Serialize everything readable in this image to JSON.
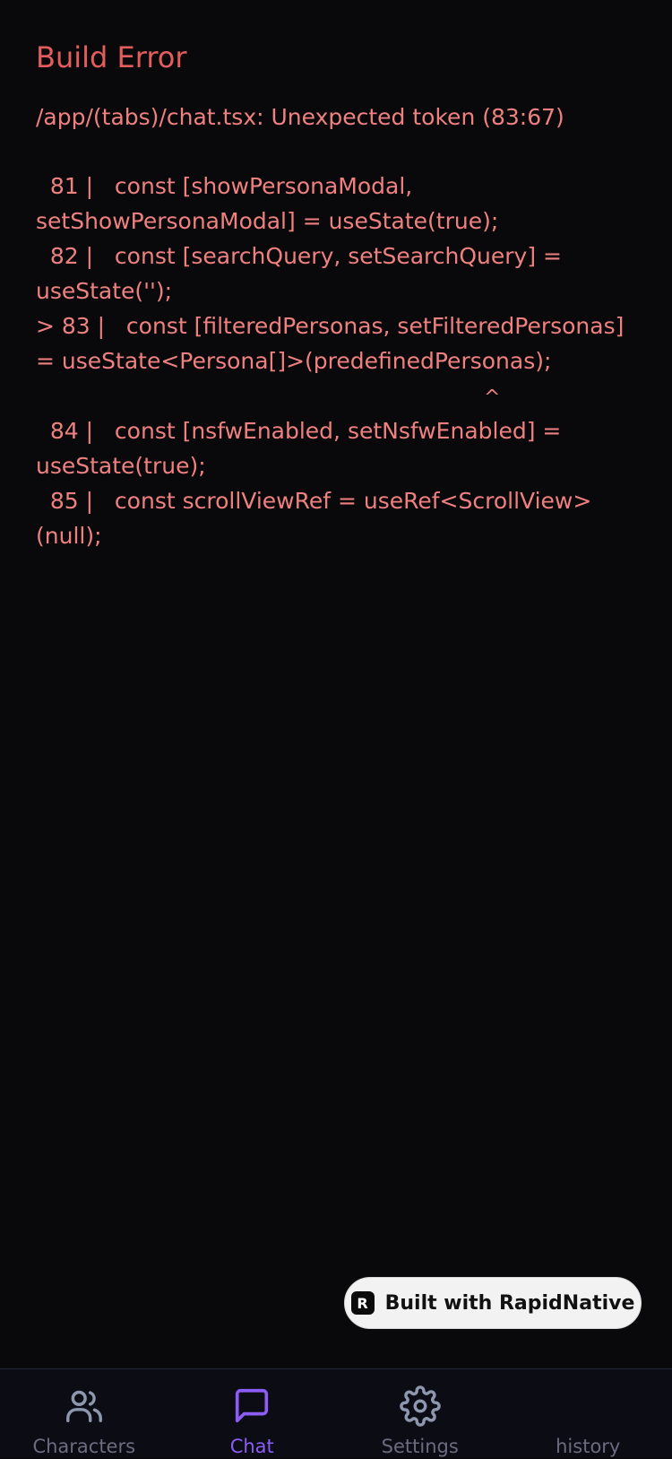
{
  "error": {
    "title": "Build Error",
    "message": "/app/(tabs)/chat.tsx: Unexpected token (83:67)",
    "code_lines": [
      "  81 |   const [showPersonaModal, setShowPersonaModal] = useState(true);",
      "  82 |   const [searchQuery, setSearchQuery] = useState('');",
      "> 83 |   const [filteredPersonas, setFilteredPersonas] = useState<Persona[]>(predefinedPersonas);",
      "^",
      "  84 |   const [nsfwEnabled, setNsfwEnabled] = useState(true);",
      "  85 |   const scrollViewRef = useRef<ScrollView>(null);"
    ]
  },
  "badge": {
    "logo": "R",
    "text": "Built with RapidNative"
  },
  "tabs": [
    {
      "label": "Characters",
      "icon": "users-icon",
      "active": false
    },
    {
      "label": "Chat",
      "icon": "chat-bubble-icon",
      "active": true
    },
    {
      "label": "Settings",
      "icon": "gear-icon",
      "active": false
    },
    {
      "label": "history",
      "icon": "",
      "active": false
    }
  ],
  "colors": {
    "background": "#09090b",
    "error_text": "#ef8080",
    "error_title": "#e35d5d",
    "tab_active": "#8b5cf6",
    "tab_inactive": "#6b6b80",
    "icon_inactive": "#8d97ad"
  }
}
